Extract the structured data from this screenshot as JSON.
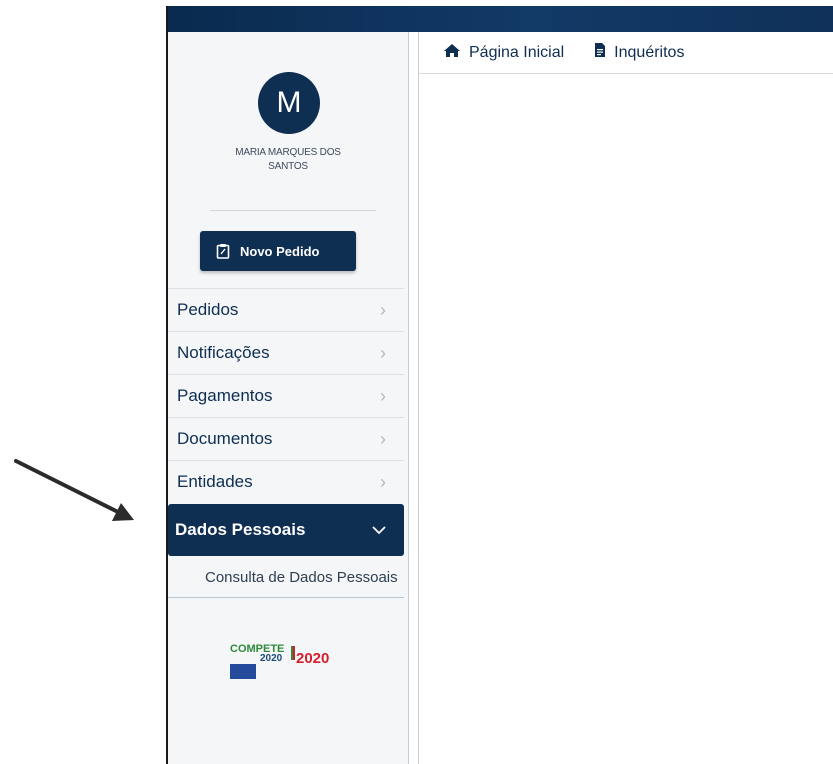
{
  "user": {
    "initial": "M",
    "name": "MARIA MARQUES DOS SANTOS"
  },
  "new_request_button": {
    "label": "Novo Pedido"
  },
  "menu": [
    {
      "label": "Pedidos"
    },
    {
      "label": "Notificações"
    },
    {
      "label": "Pagamentos"
    },
    {
      "label": "Documentos"
    },
    {
      "label": "Entidades"
    }
  ],
  "active_menu": {
    "label": "Dados Pessoais",
    "submenu": [
      {
        "label": "Consulta de Dados Pessoais"
      }
    ]
  },
  "top_nav": [
    {
      "label": "Página Inicial",
      "icon": "home-icon"
    },
    {
      "label": "Inquéritos",
      "icon": "document-icon"
    }
  ],
  "funding_logos": {
    "compete": "COMPETE",
    "compete_year": "2020",
    "portugal": "2020"
  },
  "colors": {
    "primary": "#0e2e52",
    "sidebar_bg": "#f5f6f8",
    "arrow": "#2b2b2b"
  }
}
